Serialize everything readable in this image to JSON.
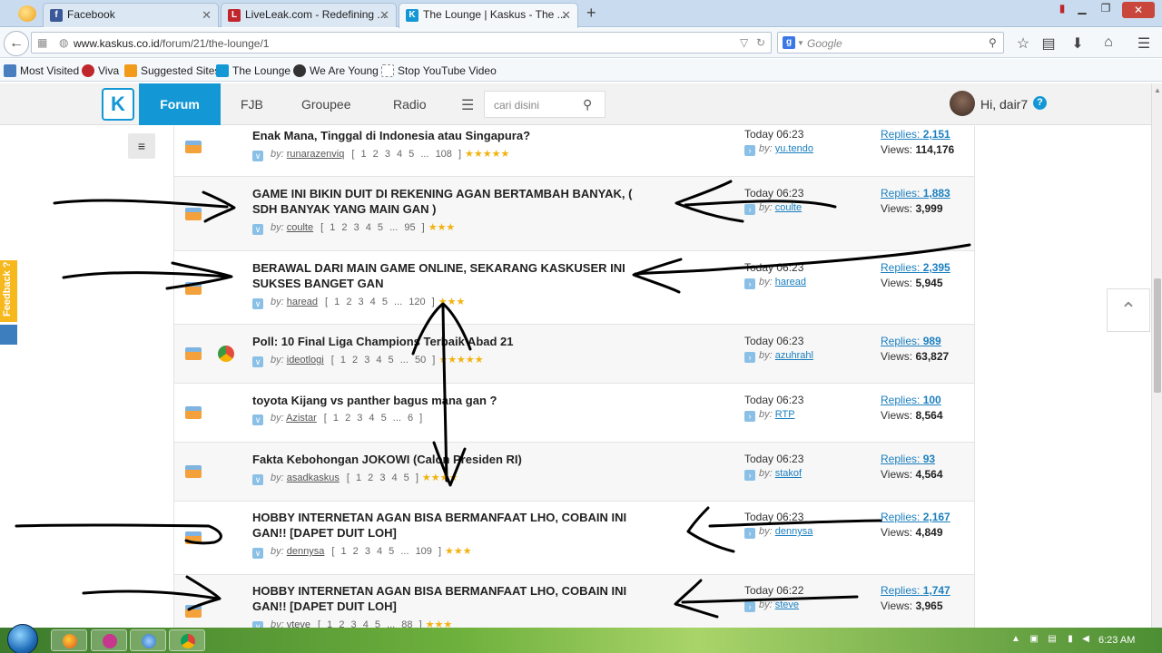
{
  "browser": {
    "tabs": [
      {
        "label": "Facebook",
        "favicon_color": "#3b5998",
        "favicon_text": "f"
      },
      {
        "label": "LiveLeak.com - Redefining ...",
        "favicon_color": "#c0272d",
        "favicon_text": "L"
      },
      {
        "label": "The Lounge | Kaskus - The ...",
        "favicon_color": "#1498d5",
        "favicon_text": "K"
      }
    ],
    "new_tab": "+",
    "url_host": "www.kaskus.co.id",
    "url_path": "/forum/21/the-lounge/1",
    "search_placeholder": "Google",
    "bookmarks": [
      {
        "label": "Most Visited",
        "color": "#4a7fbf"
      },
      {
        "label": "Viva",
        "color": "#c0272d"
      },
      {
        "label": "Suggested Sites",
        "color": "#f29a1a"
      },
      {
        "label": "The Lounge",
        "color": "#1498d5"
      },
      {
        "label": "We Are Young",
        "color": "#333333"
      },
      {
        "label": "Stop YouTube Video",
        "color": "#ffffff"
      }
    ]
  },
  "site": {
    "nav": {
      "forum": "Forum",
      "fjb": "FJB",
      "groupee": "Groupee",
      "radio": "Radio"
    },
    "search_placeholder": "cari disini",
    "greeting": "Hi, dair7",
    "help": "?",
    "feedback_label": "Feedback ?"
  },
  "threads": [
    {
      "title": "Enak Mana, Tinggal di Indonesia atau Singapura?",
      "author": "runarazenviq",
      "pages": "1 2 3 4 5 ... 108",
      "stars": "★★★★★",
      "time": "Today 06:23",
      "last_user": "yu.tendo",
      "replies": "2,151",
      "views": "114,176",
      "poll": false
    },
    {
      "title": "GAME INI BIKIN DUIT DI REKENING AGAN BERTAMBAH BANYAK, ( SDH BANYAK YANG MAIN GAN )",
      "author": "coulte",
      "pages": "1 2 3 4 5 ... 95",
      "stars": "★★★",
      "time": "Today 06:23",
      "last_user": "coulte",
      "replies": "1,883",
      "views": "3,999",
      "poll": false
    },
    {
      "title": "BERAWAL DARI MAIN GAME ONLINE, SEKARANG KASKUSER INI SUKSES BANGET GAN",
      "author": "haread",
      "pages": "1 2 3 4 5 ... 120",
      "stars": "★★★",
      "time": "Today 06:23",
      "last_user": "haread",
      "replies": "2,395",
      "views": "5,945",
      "poll": false
    },
    {
      "title": "Poll: 10 Final Liga Champions Terbaik Abad 21",
      "author": "ideotlogi",
      "pages": "1 2 3 4 5 ... 50",
      "stars": "★★★★★",
      "time": "Today 06:23",
      "last_user": "azuhrahl",
      "replies": "989",
      "views": "63,827",
      "poll": true
    },
    {
      "title": "toyota Kijang vs panther bagus mana gan ?",
      "author": "Azistar",
      "pages": "1 2 3 4 5 ... 6",
      "stars": "",
      "time": "Today 06:23",
      "last_user": "RTP",
      "replies": "100",
      "views": "8,564",
      "poll": false
    },
    {
      "title": "Fakta Kebohongan JOKOWI (Calon Presiden RI)",
      "author": "asadkaskus",
      "pages": "1 2 3 4 5",
      "stars": "★★★★",
      "time": "Today 06:23",
      "last_user": "stakof",
      "replies": "93",
      "views": "4,564",
      "poll": false
    },
    {
      "title": "HOBBY INTERNETAN AGAN BISA BERMANFAAT LHO, COBAIN INI GAN!! [DAPET DUIT LOH]",
      "author": "dennysa",
      "pages": "1 2 3 4 5 ... 109",
      "stars": "★★★",
      "time": "Today 06:23",
      "last_user": "dennysa",
      "replies": "2,167",
      "views": "4,849",
      "poll": false
    },
    {
      "title": "HOBBY INTERNETAN AGAN BISA BERMANFAAT LHO, COBAIN INI GAN!! [DAPET DUIT LOH]",
      "author": "vteve",
      "pages": "1 2 3 4 5 ... 88",
      "stars": "★★★",
      "time": "Today 06:22",
      "last_user": "steve",
      "replies": "1,747",
      "views": "3,965",
      "poll": false
    }
  ],
  "labels": {
    "by": "by:",
    "replies": "Replies:",
    "views": "Views:"
  },
  "taskbar": {
    "time": "6:23 AM"
  }
}
